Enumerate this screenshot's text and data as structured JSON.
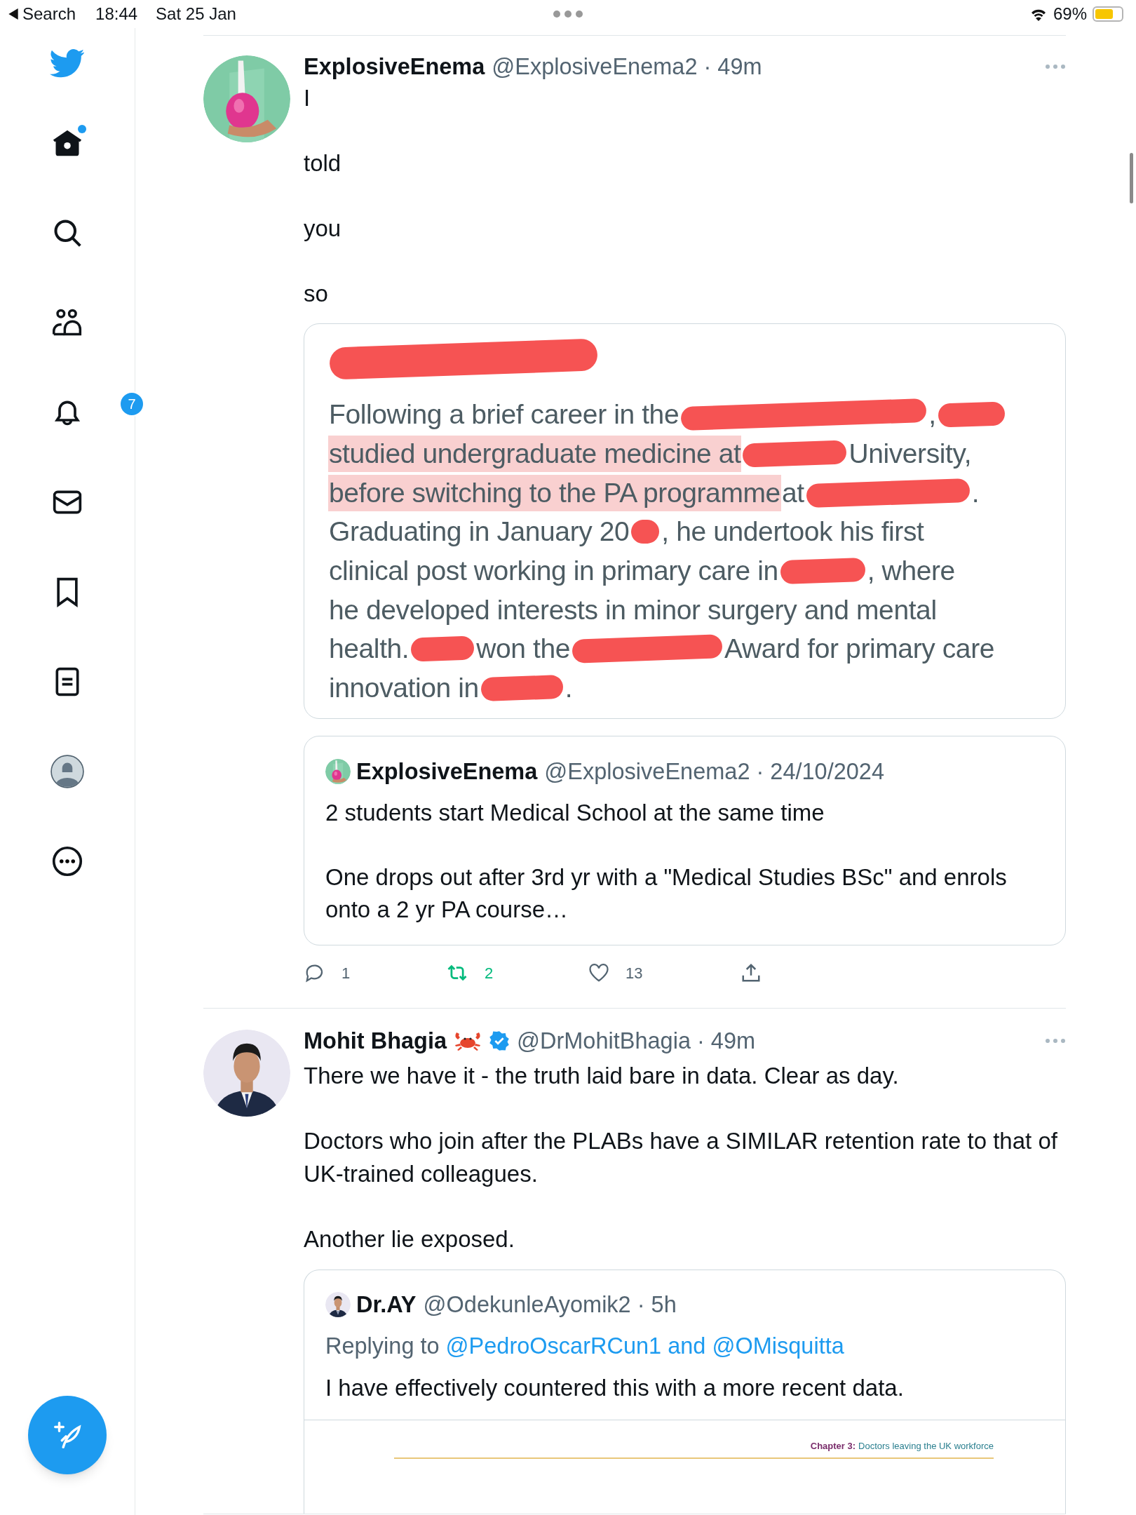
{
  "status_bar": {
    "back_label": "Search",
    "time": "18:44",
    "date": "Sat 25 Jan",
    "battery": "69%"
  },
  "sidebar": {
    "items": [
      {
        "kind": "home",
        "selected": true,
        "unread": true
      },
      {
        "kind": "search",
        "selected": false
      },
      {
        "kind": "communities",
        "selected": false
      },
      {
        "kind": "notifications",
        "selected": false,
        "badge": "7"
      },
      {
        "kind": "messages",
        "selected": false
      },
      {
        "kind": "bookmarks",
        "selected": false
      },
      {
        "kind": "lists",
        "selected": false
      },
      {
        "kind": "profile",
        "selected": false
      },
      {
        "kind": "more",
        "selected": false
      }
    ]
  },
  "tweets": [
    {
      "author": "ExplosiveEnema",
      "meta": "@ExplosiveEnema2 · 49m",
      "text": "I\n\ntold\n\nyou\n\nso",
      "media": {
        "kind": "document",
        "lines": [
          [
            {
              "kind": "redaction"
            }
          ],
          [
            {
              "kind": "text",
              "text": "Following a brief career in the"
            },
            {
              "kind": "redaction"
            },
            {
              "kind": "text",
              "text": ","
            },
            {
              "kind": "redaction"
            }
          ],
          [
            {
              "kind": "text",
              "text": "studied undergraduate medicine at",
              "highlighted": true
            },
            {
              "kind": "redaction"
            },
            {
              "kind": "text",
              "text": "University,"
            }
          ],
          [
            {
              "kind": "text",
              "text": "before switching to the PA programme",
              "highlighted": true
            },
            {
              "kind": "text",
              "text": "at"
            },
            {
              "kind": "redaction"
            },
            {
              "kind": "text",
              "text": "."
            }
          ],
          [
            {
              "kind": "text",
              "text": "Graduating in January 20"
            },
            {
              "kind": "redaction"
            },
            {
              "kind": "text",
              "text": ", he undertook his first"
            }
          ],
          [
            {
              "kind": "text",
              "text": "clinical post working in primary care in"
            },
            {
              "kind": "redaction"
            },
            {
              "kind": "text",
              "text": ", where"
            }
          ],
          [
            {
              "kind": "text",
              "text": "he developed interests in minor surgery and mental"
            }
          ],
          [
            {
              "kind": "text",
              "text": "health."
            },
            {
              "kind": "redaction"
            },
            {
              "kind": "text",
              "text": "won the"
            },
            {
              "kind": "redaction"
            },
            {
              "kind": "text",
              "text": "Award for primary care"
            }
          ],
          [
            {
              "kind": "text",
              "text": "innovation in"
            },
            {
              "kind": "redaction"
            },
            {
              "kind": "text",
              "text": "."
            }
          ]
        ]
      },
      "quote": {
        "author": "ExplosiveEnema",
        "meta": "@ExplosiveEnema2 · 24/10/2024",
        "text": "2 students start Medical School at the same time\n\nOne drops out after 3rd yr with a \"Medical Studies BSc\" and enrols onto a 2 yr PA course…"
      },
      "actions": {
        "replies": "1",
        "retweets": "2",
        "likes": "13",
        "retweeted": true,
        "liked": false
      }
    },
    {
      "author": "Mohit Bhagia",
      "crab": true,
      "verified": true,
      "meta": "@DrMohitBhagia · 49m",
      "text": "There we have it - the truth laid bare in data. Clear as day.\n\nDoctors who join after the PLABs have a SIMILAR retention rate to that of UK-trained colleagues.\n\nAnother lie exposed.",
      "quote": {
        "author": "Dr.AY",
        "meta": "@OdekunleAyomik2 · 5h",
        "reply_prefix": "Replying to",
        "reply_to": "@PedroOscarRCun1 and @OMisquitta",
        "text": "I have effectively countered this with a more recent data.",
        "media": {
          "kind": "document_header",
          "chapter": "Chapter 3:",
          "title": "Doctors leaving the UK workforce"
        }
      }
    }
  ]
}
